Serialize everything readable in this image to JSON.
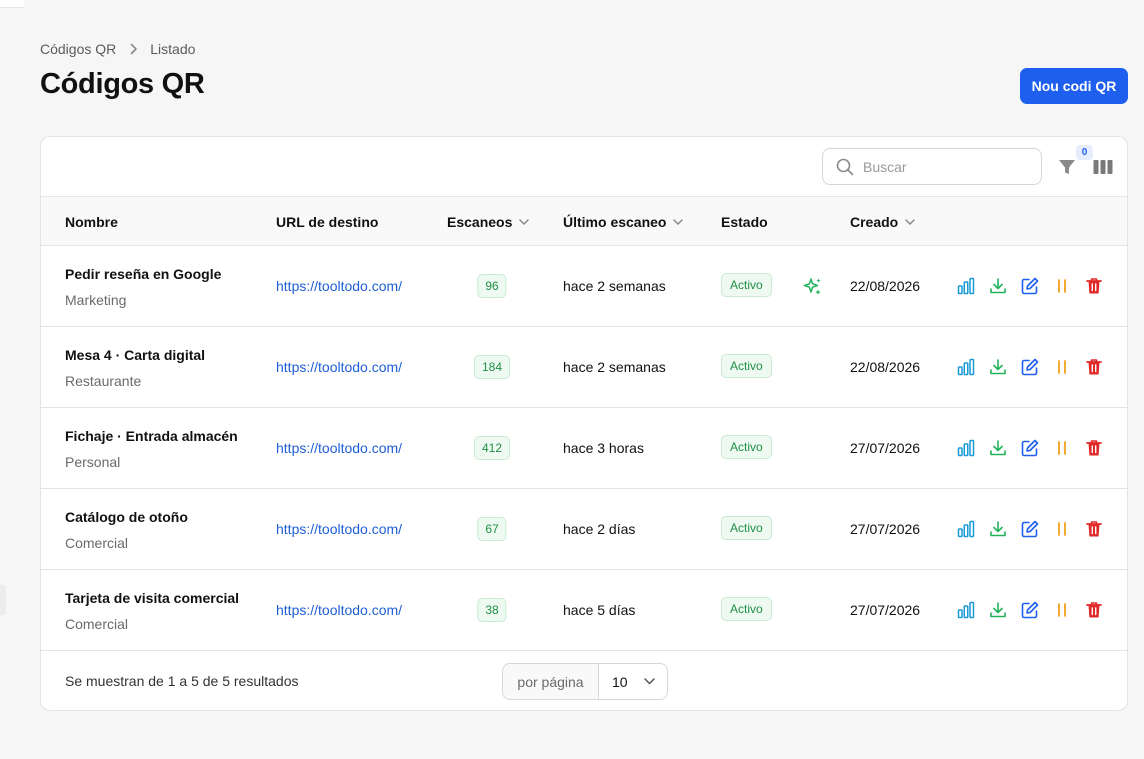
{
  "breadcrumb": {
    "parent": "Códigos QR",
    "current": "Listado"
  },
  "page_title": "Códigos QR",
  "primary_button": "Nou codi QR",
  "search": {
    "placeholder": "Buscar",
    "value": ""
  },
  "filter_count": "0",
  "columns": {
    "name": "Nombre",
    "url": "URL de destino",
    "scans": "Escaneos",
    "last_scan": "Último escaneo",
    "status": "Estado",
    "created": "Creado"
  },
  "rows": [
    {
      "title": "Pedir reseña en Google",
      "category": "Marketing",
      "url": "https://tooltodo.com/",
      "scans": "96",
      "last_scan": "hace 2 semanas",
      "status": "Activo",
      "ai": true,
      "created": "22/08/2026"
    },
    {
      "title": "Mesa 4 · Carta digital",
      "category": "Restaurante",
      "url": "https://tooltodo.com/",
      "scans": "184",
      "last_scan": "hace 2 semanas",
      "status": "Activo",
      "ai": false,
      "created": "22/08/2026"
    },
    {
      "title": "Fichaje · Entrada almacén",
      "category": "Personal",
      "url": "https://tooltodo.com/",
      "scans": "412",
      "last_scan": "hace 3 horas",
      "status": "Activo",
      "ai": false,
      "created": "27/07/2026"
    },
    {
      "title": "Catálogo de otoño",
      "category": "Comercial",
      "url": "https://tooltodo.com/",
      "scans": "67",
      "last_scan": "hace 2 días",
      "status": "Activo",
      "ai": false,
      "created": "27/07/2026"
    },
    {
      "title": "Tarjeta de visita comercial",
      "category": "Comercial",
      "url": "https://tooltodo.com/",
      "scans": "38",
      "last_scan": "hace 5 días",
      "status": "Activo",
      "ai": false,
      "created": "27/07/2026"
    }
  ],
  "row_actions": [
    {
      "icon": "stats-icon",
      "color": "#1a9ad6"
    },
    {
      "icon": "download-icon",
      "color": "#22b35a"
    },
    {
      "icon": "edit-icon",
      "color": "#1e5ff0"
    },
    {
      "icon": "pause-icon",
      "color": "#f0a21a"
    },
    {
      "icon": "trash-icon",
      "color": "#e02a2a"
    }
  ],
  "footer": {
    "results": "Se muestran de 1 a 5 de 5 resultados",
    "per_page_label": "por página",
    "per_page_value": "10"
  },
  "colors": {
    "accent": "#1e5ff0",
    "success": "#1f8f45",
    "link": "#1f5fd6"
  }
}
